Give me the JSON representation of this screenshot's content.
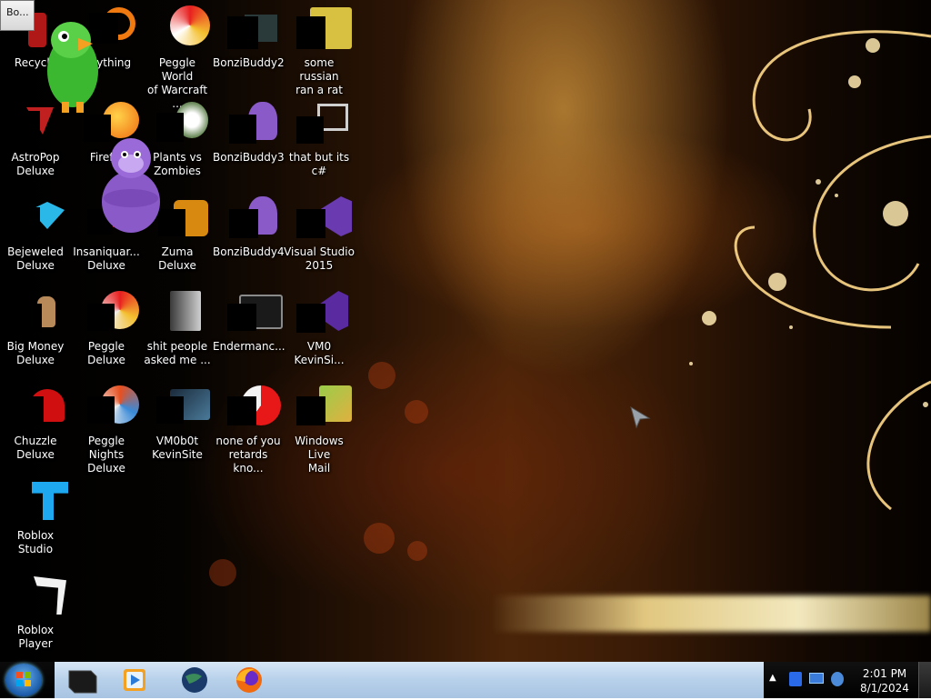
{
  "notification": {
    "label": "Bo..."
  },
  "desktop_icons": [
    {
      "label": "Recycle",
      "name": "recycle-bin"
    },
    {
      "label": "...rything",
      "name": "everything"
    },
    {
      "label": "Peggle World\nof Warcraft ...",
      "name": "peggle-world-of-warcraft"
    },
    {
      "label": "BonziBuddy2",
      "name": "bonzibuddy2"
    },
    {
      "label": "some russian\nran a rat",
      "name": "some-russian-ran-a-rat"
    },
    {
      "label": "AstroPop\nDeluxe",
      "name": "astropop-deluxe"
    },
    {
      "label": "Firef...",
      "name": "firefox"
    },
    {
      "label": "Plants vs\nZombies",
      "name": "plants-vs-zombies"
    },
    {
      "label": "BonziBuddy3",
      "name": "bonzibuddy3"
    },
    {
      "label": "that but its c#",
      "name": "that-but-its-csharp"
    },
    {
      "label": "Bejeweled\nDeluxe",
      "name": "bejeweled-deluxe"
    },
    {
      "label": "Insaniquar...\nDeluxe",
      "name": "insaniquarium-deluxe"
    },
    {
      "label": "Zuma Deluxe",
      "name": "zuma-deluxe"
    },
    {
      "label": "BonziBuddy4",
      "name": "bonzibuddy4"
    },
    {
      "label": "Visual Studio\n2015",
      "name": "visual-studio-2015"
    },
    {
      "label": "Big Money\nDeluxe",
      "name": "big-money-deluxe"
    },
    {
      "label": "Peggle Deluxe",
      "name": "peggle-deluxe"
    },
    {
      "label": "shit people\nasked me ...",
      "name": "shit-people-asked-me"
    },
    {
      "label": "Endermanc...",
      "name": "endermanch"
    },
    {
      "label": "VM0\nKevinSi...",
      "name": "vm0-kevinsite"
    },
    {
      "label": "Chuzzle\nDeluxe",
      "name": "chuzzle-deluxe"
    },
    {
      "label": "Peggle Nights\nDeluxe",
      "name": "peggle-nights-deluxe"
    },
    {
      "label": "VM0b0t\nKevinSite",
      "name": "vm0b0t-kevinsite"
    },
    {
      "label": "none of you\nretards kno...",
      "name": "none-of-you"
    },
    {
      "label": "Windows Live\nMail",
      "name": "windows-live-mail"
    },
    {
      "label": "Roblox Studio",
      "name": "roblox-studio"
    },
    {
      "label": "Roblox Player",
      "name": "roblox-player"
    }
  ],
  "taskbar": {
    "apps": [
      "task-app-black-box",
      "windows-media-player",
      "earth-globe",
      "firefox"
    ]
  },
  "clock": {
    "time": "2:01 PM",
    "date": "8/1/2024"
  },
  "colors": {
    "taskbar_glass": "#b7d0ea",
    "start_orb": "#1a5aa8"
  }
}
